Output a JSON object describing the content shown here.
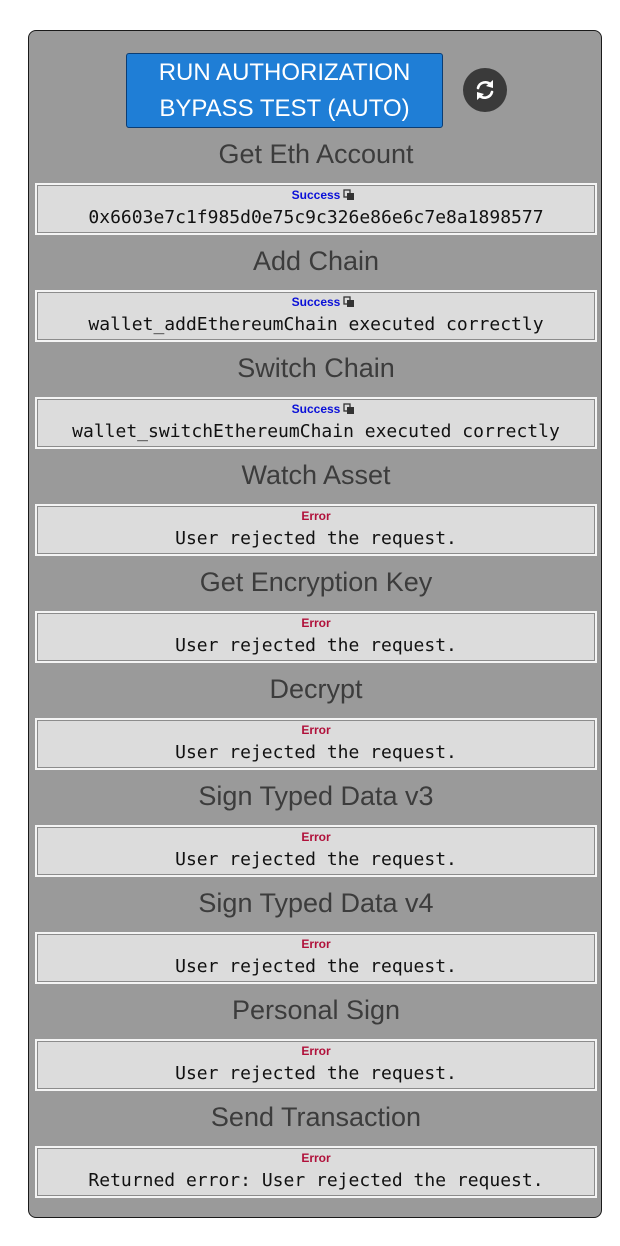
{
  "header": {
    "run_button_line1": "RUN AUTHORIZATION",
    "run_button_line2": "BYPASS TEST (AUTO)"
  },
  "sections": [
    {
      "title": "Get Eth Account",
      "status": "Success",
      "status_type": "success",
      "copyable": true,
      "message": "0x6603e7c1f985d0e75c9c326e86e6c7e8a1898577"
    },
    {
      "title": "Add Chain",
      "status": "Success",
      "status_type": "success",
      "copyable": true,
      "message": "wallet_addEthereumChain executed correctly"
    },
    {
      "title": "Switch Chain",
      "status": "Success",
      "status_type": "success",
      "copyable": true,
      "message": "wallet_switchEthereumChain executed correctly"
    },
    {
      "title": "Watch Asset",
      "status": "Error",
      "status_type": "error",
      "copyable": false,
      "message": "User rejected the request."
    },
    {
      "title": "Get Encryption Key",
      "status": "Error",
      "status_type": "error",
      "copyable": false,
      "message": "User rejected the request."
    },
    {
      "title": "Decrypt",
      "status": "Error",
      "status_type": "error",
      "copyable": false,
      "message": "User rejected the request."
    },
    {
      "title": "Sign Typed Data v3",
      "status": "Error",
      "status_type": "error",
      "copyable": false,
      "message": "User rejected the request."
    },
    {
      "title": "Sign Typed Data v4",
      "status": "Error",
      "status_type": "error",
      "copyable": false,
      "message": "User rejected the request."
    },
    {
      "title": "Personal Sign",
      "status": "Error",
      "status_type": "error",
      "copyable": false,
      "message": "User rejected the request."
    },
    {
      "title": "Send Transaction",
      "status": "Error",
      "status_type": "error",
      "copyable": false,
      "message": "Returned error: User rejected the request."
    }
  ],
  "colors": {
    "panel_bg": "#9a9a9a",
    "button_bg": "#1f7ed6",
    "success": "#0a10d8",
    "error": "#b0103a"
  },
  "icons": {
    "refresh": "refresh-icon",
    "copy": "copy-icon"
  }
}
